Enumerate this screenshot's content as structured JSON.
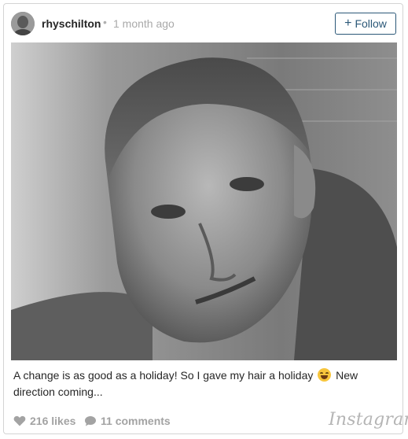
{
  "header": {
    "username": "rhyschilton",
    "separator": "•",
    "timestamp": "1 month ago",
    "follow_label": "Follow",
    "follow_prefix": "+"
  },
  "post": {
    "caption_before_emoji": "A change is as good as a holiday! So I gave my hair a holiday ",
    "caption_after_emoji": " New direction coming...",
    "emoji_icon": "face-with-tears-of-joy-icon"
  },
  "footer": {
    "likes": "216 likes",
    "comments": "11 comments",
    "brand": "Instagram"
  },
  "colors": {
    "follow_accent": "#2b5878",
    "meta_gray": "#a3a3a3"
  }
}
